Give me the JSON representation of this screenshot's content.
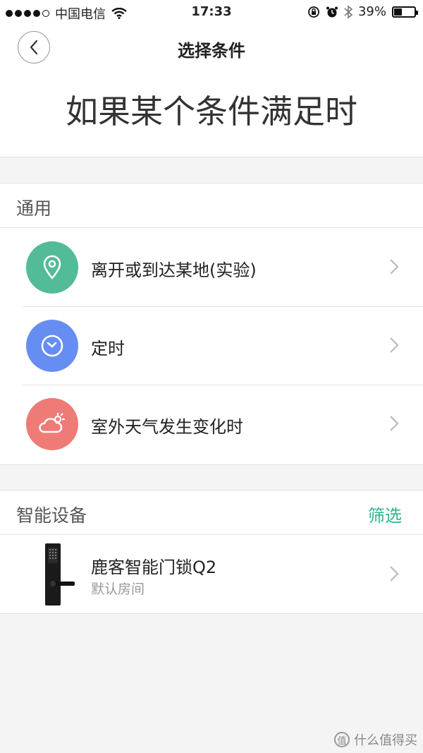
{
  "status_bar": {
    "carrier": "中国电信",
    "time": "17:33",
    "battery_text": "39%",
    "battery_level": 0.39
  },
  "nav": {
    "title": "选择条件",
    "back_icon": "chevron-left-icon"
  },
  "headline": "如果某个条件满足时",
  "general": {
    "title": "通用",
    "items": [
      {
        "label": "离开或到达某地(实验)",
        "icon": "location-pin-icon",
        "color": "#52bb97"
      },
      {
        "label": "定时",
        "icon": "clock-icon",
        "color": "#668ef2"
      },
      {
        "label": "室外天气发生变化时",
        "icon": "weather-icon",
        "color": "#ef7b77"
      }
    ]
  },
  "devices": {
    "title": "智能设备",
    "filter_label": "筛选",
    "items": [
      {
        "name": "鹿客智能门锁Q2",
        "room": "默认房间",
        "icon": "door-lock-icon"
      }
    ]
  },
  "watermark": {
    "badge": "值",
    "text": "什么值得买"
  },
  "colors": {
    "accent": "#2fb58f",
    "background": "#f4f4f4"
  }
}
